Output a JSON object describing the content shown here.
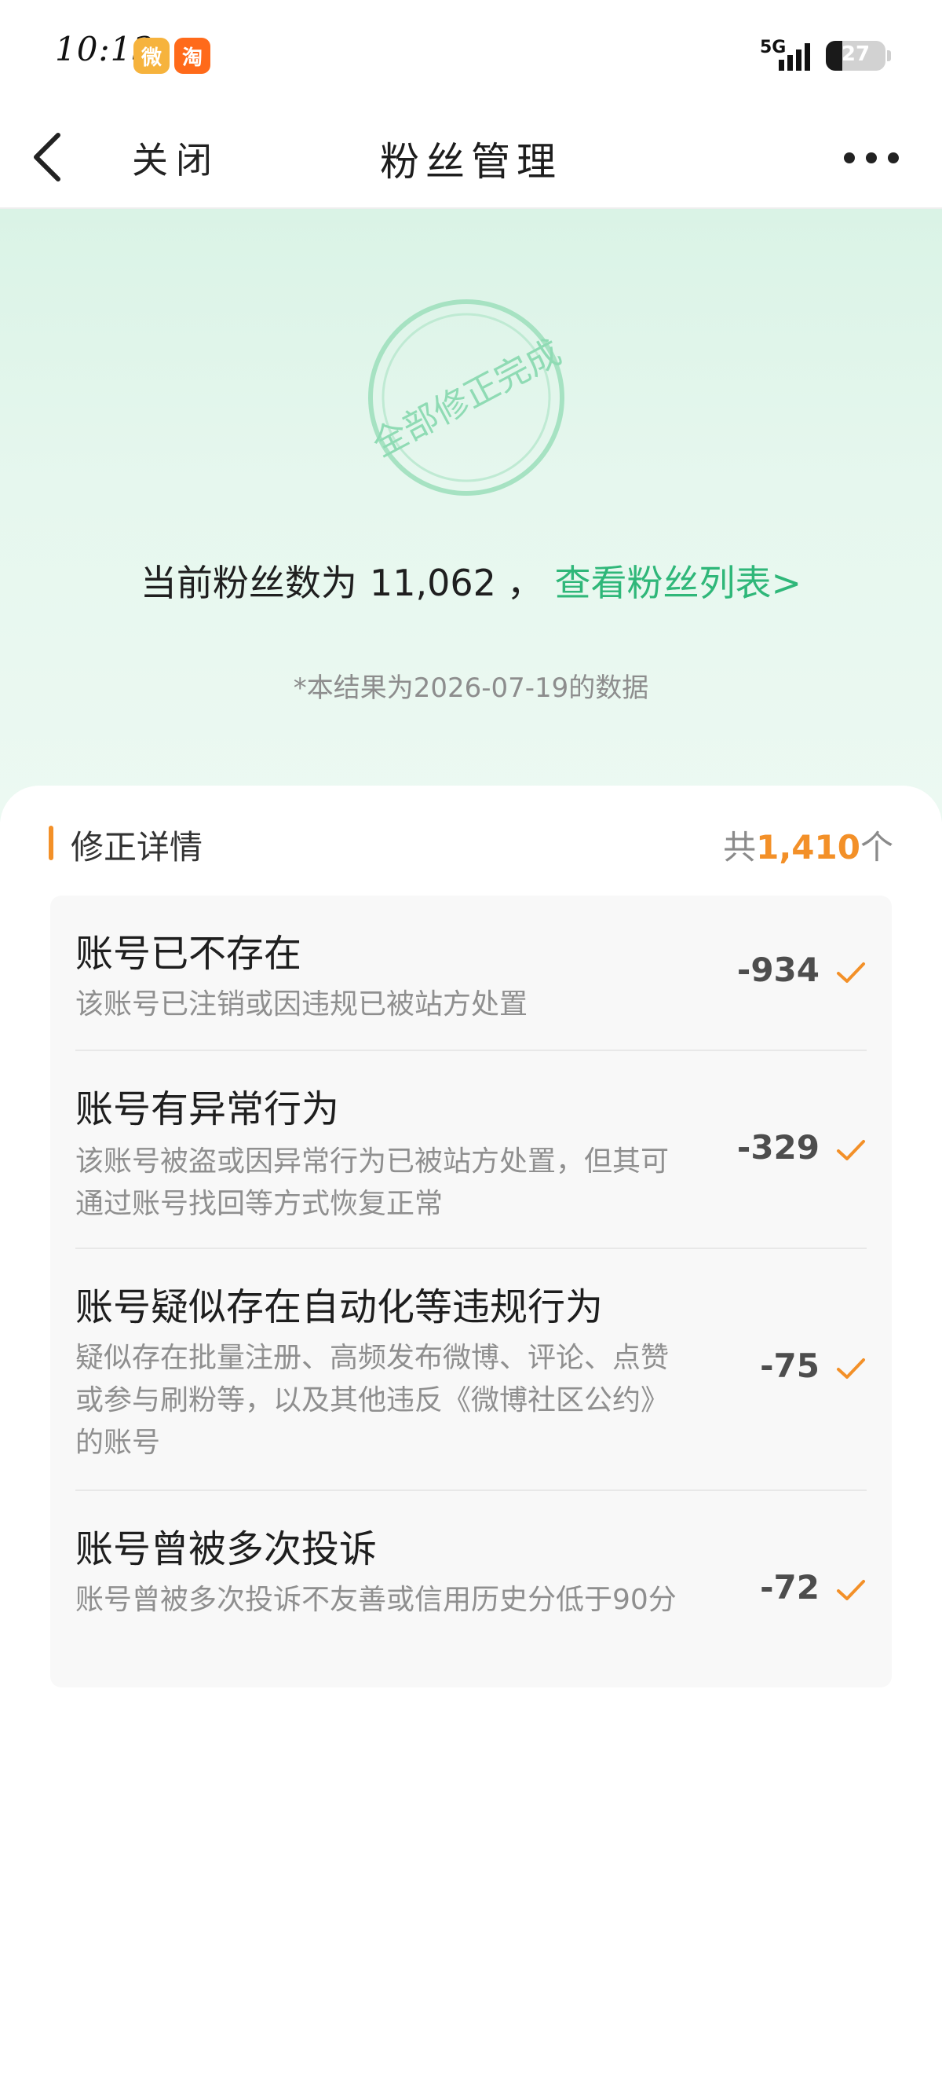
{
  "status_bar": {
    "time": "10:13",
    "network": "5G",
    "battery_percent": 27,
    "battery_label": "27",
    "apps": [
      {
        "name": "weibo-icon",
        "glyph": "微"
      },
      {
        "name": "taobao-icon",
        "glyph": "淘"
      }
    ]
  },
  "nav": {
    "close_label": "关闭",
    "title": "粉丝管理"
  },
  "hero": {
    "stamp_text": "全部修正完成",
    "summary_prefix": "当前粉丝数为",
    "fan_count": "11,062",
    "summary_sep": "，",
    "view_fans_link": "查看粉丝列表>",
    "date_note": "*本结果为2026-07-19的数据",
    "accent_color": "#2fb779"
  },
  "details": {
    "title": "修正详情",
    "total_prefix": "共",
    "total_number": "1,410",
    "total_suffix": "个",
    "accent_color": "#f39028",
    "items": [
      {
        "title": "账号已不存在",
        "desc": "该账号已注销或因违规已被站方处置",
        "value": "-934"
      },
      {
        "title": "账号有异常行为",
        "desc": "该账号被盗或因异常行为已被站方处置，但其可通过账号找回等方式恢复正常",
        "value": "-329"
      },
      {
        "title": "账号疑似存在自动化等违规行为",
        "desc": "疑似存在批量注册、高频发布微博、评论、点赞或参与刷粉等，以及其他违反《微博社区公约》的账号",
        "value": "-75"
      },
      {
        "title": "账号曾被多次投诉",
        "desc": "账号曾被多次投诉不友善或信用历史分低于90分",
        "value": "-72"
      }
    ]
  }
}
